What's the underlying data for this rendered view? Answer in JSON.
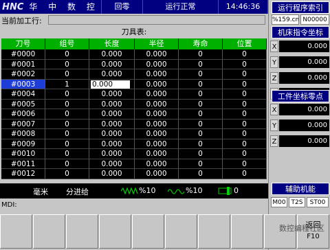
{
  "topbar": {
    "brand": "HNC",
    "brand_cn": "华 中 数 控",
    "mode": "回零",
    "status": "运行正常",
    "time": "14:46:36"
  },
  "current_line": {
    "label": "当前加工行:",
    "value": ""
  },
  "tool_table": {
    "title": "刀具表:",
    "headers": [
      "刀号",
      "组号",
      "长度",
      "半径",
      "寿命",
      "位置"
    ],
    "rows": [
      [
        "#0000",
        "0",
        "0.000",
        "0.000",
        "0",
        "0"
      ],
      [
        "#0001",
        "0",
        "0.000",
        "0.000",
        "0",
        "0"
      ],
      [
        "#0002",
        "0",
        "0.000",
        "0.000",
        "0",
        "0"
      ],
      [
        "#0003",
        "1",
        "0.000",
        "0.000",
        "0",
        "0"
      ],
      [
        "#0004",
        "0",
        "0.000",
        "0.000",
        "0",
        "0"
      ],
      [
        "#0005",
        "0",
        "0.000",
        "0.000",
        "0",
        "0"
      ],
      [
        "#0006",
        "0",
        "0.000",
        "0.000",
        "0",
        "0"
      ],
      [
        "#0007",
        "0",
        "0.000",
        "0.000",
        "0",
        "0"
      ],
      [
        "#0008",
        "0",
        "0.000",
        "0.000",
        "0",
        "0"
      ],
      [
        "#0009",
        "0",
        "0.000",
        "0.000",
        "0",
        "0"
      ],
      [
        "#0010",
        "0",
        "0.000",
        "0.000",
        "0",
        "0"
      ],
      [
        "#0011",
        "0",
        "0.000",
        "0.000",
        "0",
        "0"
      ],
      [
        "#0012",
        "0",
        "0.000",
        "0.000",
        "0",
        "0"
      ]
    ],
    "selected_row": 3
  },
  "bottom_status": {
    "unit": "毫米",
    "feed_mode": "分进给",
    "feed_override": "%10",
    "rapid_override": "%10",
    "spindle_override": "0"
  },
  "mdi_label": "MDI:",
  "right_panel": {
    "program_index_title": "运行程序索引",
    "program_file": "%159.cnc",
    "program_line": "N00000",
    "machine_coord_title": "机床指令坐标",
    "machine_coords": [
      {
        "axis": "X",
        "value": "0.000"
      },
      {
        "axis": "Y",
        "value": "0.000"
      },
      {
        "axis": "Z",
        "value": "0.000"
      },
      {
        "axis": "F",
        "value": "0.000"
      }
    ],
    "work_zero_title": "工件坐标零点",
    "work_zero": [
      {
        "axis": "X",
        "value": "0.000"
      },
      {
        "axis": "Y",
        "value": "0.000"
      },
      {
        "axis": "Z",
        "value": "0.000"
      }
    ],
    "aux_title": "辅助机能",
    "m_code": "M00",
    "t_code": "T2S",
    "s_code": "ST00"
  },
  "softkeys": [
    {
      "label": "",
      "fkey": ""
    },
    {
      "label": "",
      "fkey": ""
    },
    {
      "label": "",
      "fkey": ""
    },
    {
      "label": "",
      "fkey": ""
    },
    {
      "label": "",
      "fkey": ""
    },
    {
      "label": "",
      "fkey": ""
    },
    {
      "label": "",
      "fkey": ""
    },
    {
      "label": "",
      "fkey": ""
    },
    {
      "label": "",
      "fkey": ""
    },
    {
      "label": "返回",
      "fkey": "F10"
    }
  ],
  "watermark": "数控编程社区",
  "colors": {
    "title_bar": "#000080",
    "table_header": "#00b000",
    "cell_bg": "#000000",
    "selected": "#1e3cd6"
  }
}
